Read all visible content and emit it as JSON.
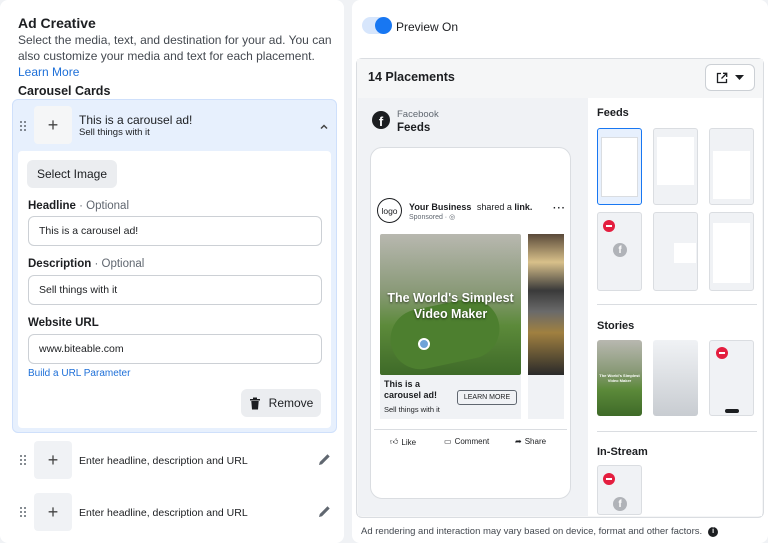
{
  "left": {
    "title": "Ad Creative",
    "subtitle": "Select the media, text, and destination for your ad. You can also customize your media and text for each placement.",
    "learn_more": "Learn More",
    "carousel_title": "Carousel Cards",
    "card1": {
      "headline": "This is a carousel ad!",
      "description": "Sell things with it",
      "select_image": "Select Image",
      "headline_label": "Headline",
      "headline_optional": "· Optional",
      "headline_value": "This is a carousel ad!",
      "description_label": "Description",
      "description_optional": "· Optional",
      "description_value": "Sell things with it",
      "url_label": "Website URL",
      "url_value": "www.biteable.com",
      "url_param": "Build a URL Parameter",
      "remove": "Remove"
    },
    "card2": {
      "text": "Enter headline, description and URL"
    },
    "card3": {
      "text": "Enter headline, description and URL"
    }
  },
  "right": {
    "preview_label": "Preview On",
    "placements_title": "14 Placements",
    "platform": "Facebook",
    "placement": "Feeds",
    "post": {
      "business": "Your Business",
      "shared": "shared a",
      "link": "link.",
      "sponsored": "Sponsored · ",
      "logo_text": "logo",
      "overlay": "The World's Simplest Video Maker",
      "card_headline": "This is a carousel ad!",
      "card_description": "Sell things with it",
      "cta": "LEARN MORE",
      "like": "Like",
      "comment": "Comment",
      "share": "Share"
    },
    "sections": {
      "feeds": "Feeds",
      "stories": "Stories",
      "instream": "In-Stream"
    },
    "mini_story_text": "The World's Simplest Video Maker",
    "footer_note": "Ad rendering and interaction may vary based on device, format and other factors."
  },
  "colors": {
    "accent": "#1877f2",
    "link": "#1d6fd8",
    "panel_bg": "#f0f2f5",
    "remove_red": "#e41e3f"
  }
}
